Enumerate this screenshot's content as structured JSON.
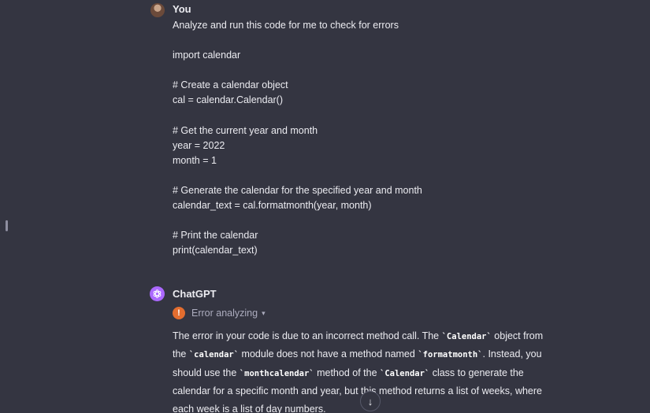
{
  "user_turn": {
    "author": "You",
    "lines": [
      "Analyze and run this code for me to check for errors",
      "",
      "import calendar",
      "",
      "# Create a calendar object",
      "cal = calendar.Calendar()",
      "",
      "# Get the current year and month",
      "year = 2022",
      "month = 1",
      "",
      "# Generate the calendar for the specified year and month",
      "calendar_text = cal.formatmonth(year, month)",
      "",
      "# Print the calendar",
      "print(calendar_text)"
    ]
  },
  "assistant_turn": {
    "author": "ChatGPT",
    "status": {
      "icon": "!",
      "label": "Error analyzing",
      "color": "#e36d2f"
    },
    "paragraph": {
      "t0": "The error in your code is due to an incorrect method call. The ",
      "c0": "`Calendar`",
      "t1": " object from the ",
      "c1": "`calendar`",
      "t2": " module does not have a method named ",
      "c2": "`formatmonth`",
      "t3": ". Instead, you should use the ",
      "c3": "`monthcalendar`",
      "t4": " method of the ",
      "c4": "`Calendar`",
      "t5": " class to generate the calendar for a specific month and year, but this method returns a list of weeks, where each week is a list of day numbers."
    }
  },
  "colors": {
    "background": "#343541",
    "gpt_avatar": "#ab68ff",
    "text": "#ececf1",
    "muted": "#acacbe"
  }
}
